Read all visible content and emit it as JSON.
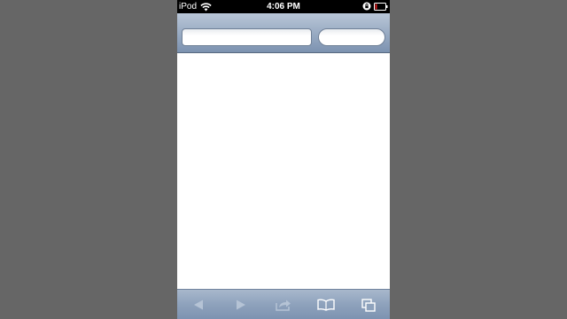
{
  "status_bar": {
    "carrier": "iPod",
    "time": "4:06 PM",
    "icons": [
      "wifi-icon",
      "orientation-lock-icon",
      "battery-icon"
    ]
  },
  "address_bar": {
    "url_value": "",
    "search_value": ""
  },
  "toolbar": {
    "buttons": [
      "back-icon",
      "forward-icon",
      "share-icon",
      "bookmarks-icon",
      "tabs-icon"
    ]
  },
  "colors": {
    "background": "#666666",
    "status_bar": "#000000",
    "bar_gradient_top": "#b9c6d7",
    "bar_gradient_bottom": "#7c92b0",
    "battery_low": "#e02020"
  }
}
